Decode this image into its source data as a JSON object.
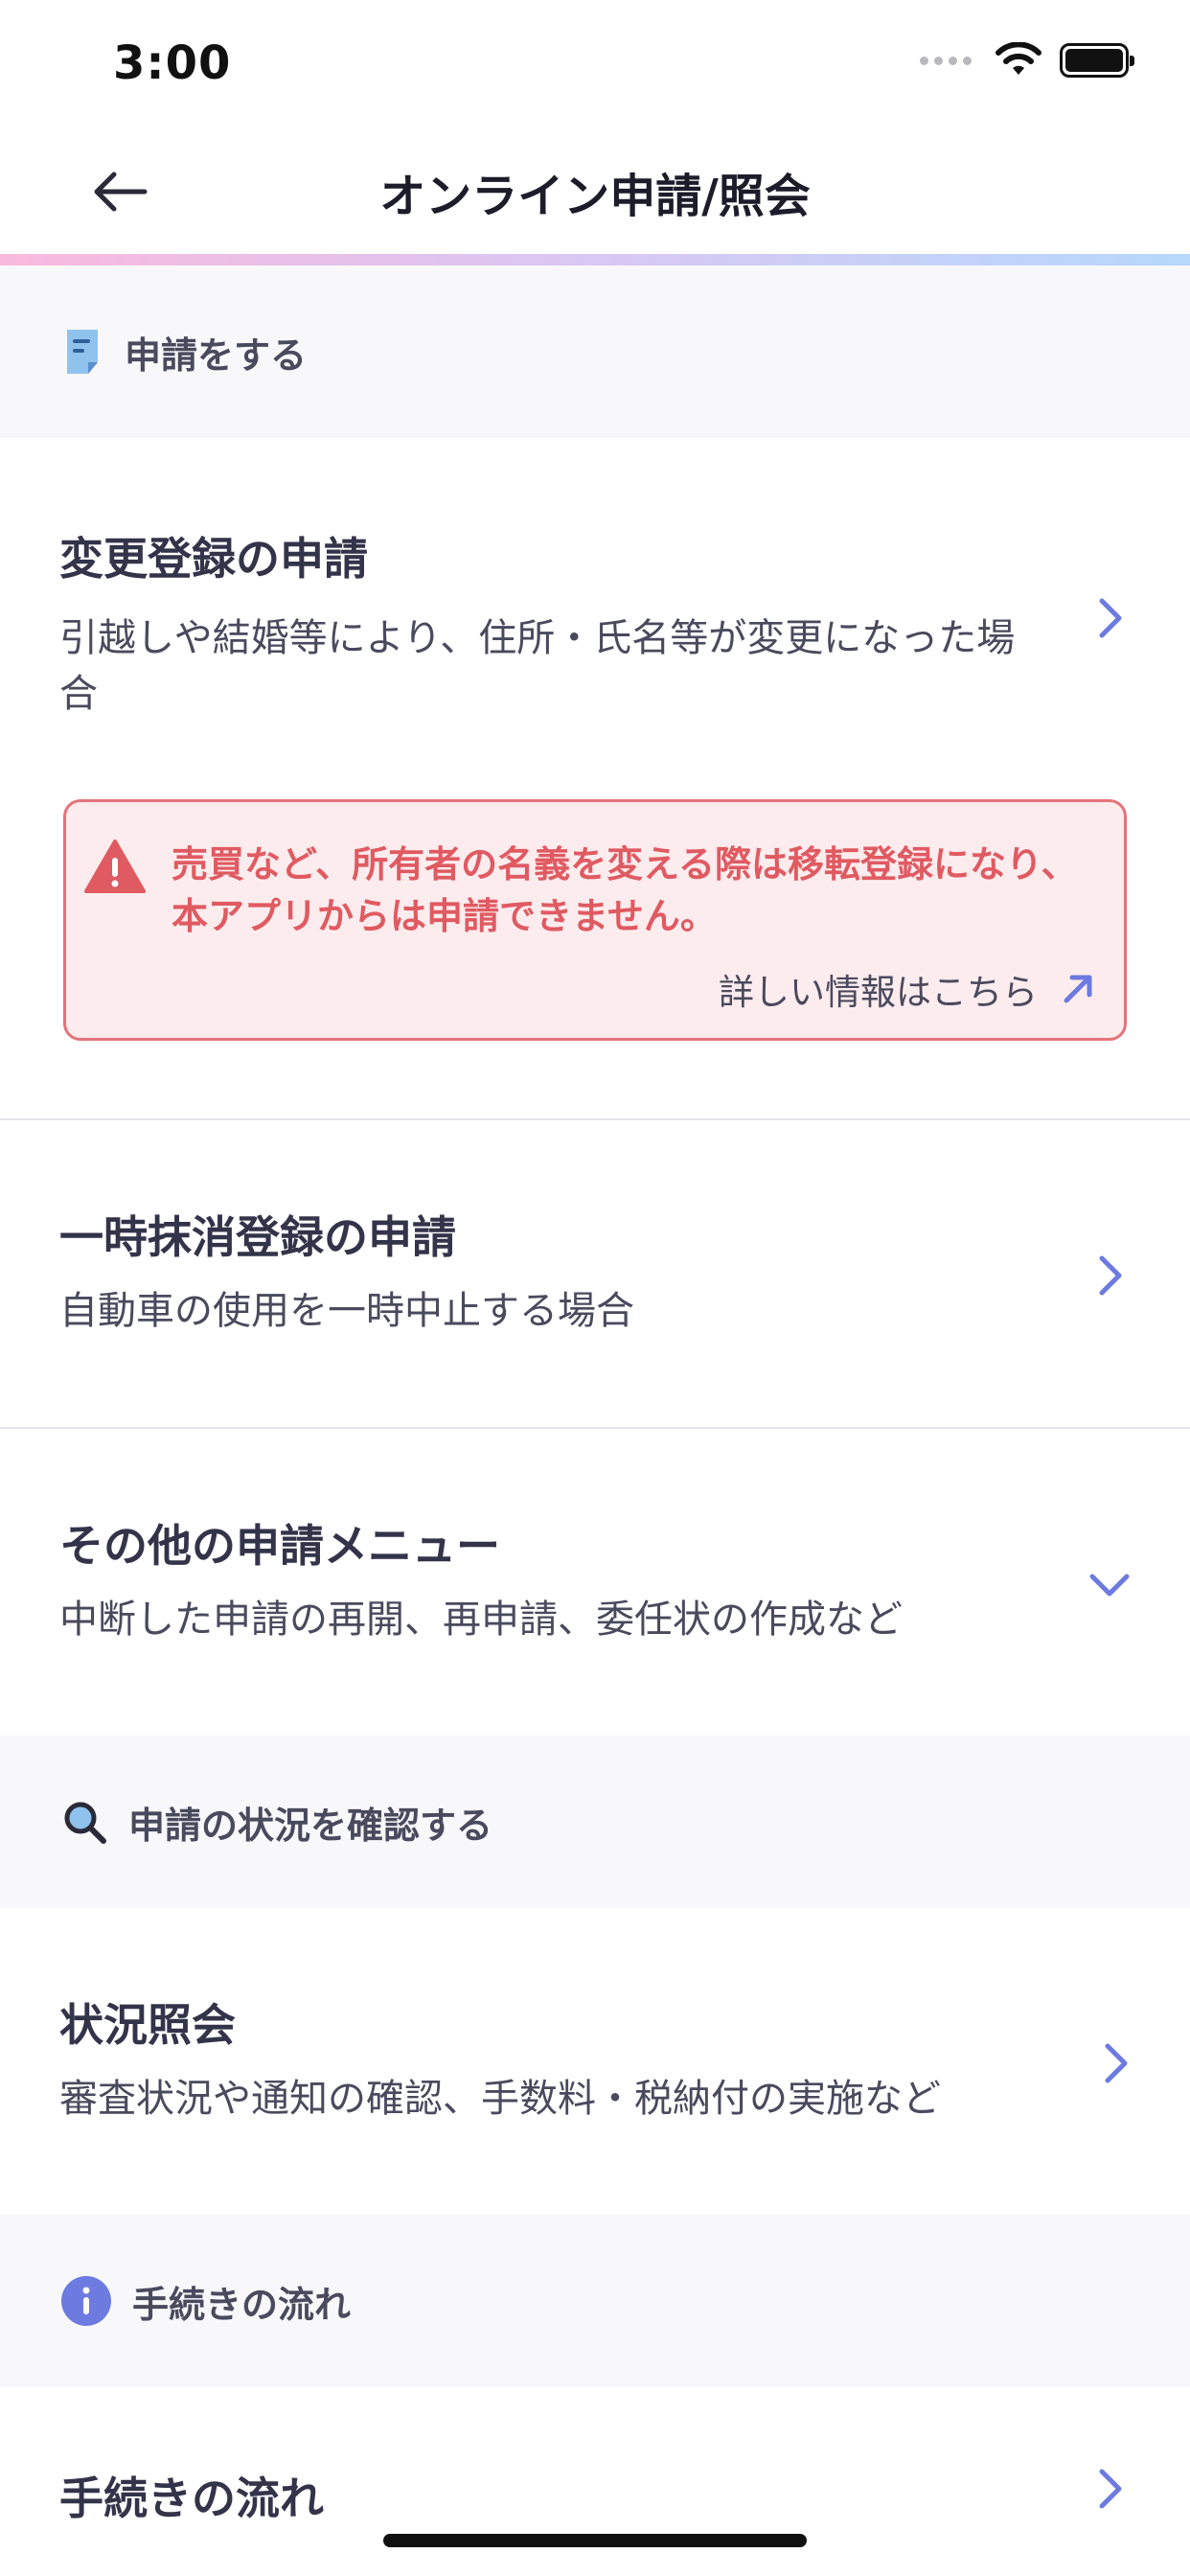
{
  "status_bar": {
    "time": "3:00"
  },
  "nav": {
    "title": "オンライン申請/照会"
  },
  "section_apply": {
    "label": "申請をする"
  },
  "change_registration": {
    "title": "変更登録の申請",
    "description": "引越しや結婚等により、住所・氏名等が変更になった場合"
  },
  "warning": {
    "message": "売買など、所有者の名義を変える際は移転登録になり、本アプリからは申請できません。",
    "link_label": "詳しい情報はこちら"
  },
  "temporary_deregistration": {
    "title": "一時抹消登録の申請",
    "description": "自動車の使用を一時中止する場合"
  },
  "other_menu": {
    "title": "その他の申請メニュー",
    "description": "中断した申請の再開、再申請、委任状の作成など"
  },
  "section_status": {
    "label": "申請の状況を確認する"
  },
  "status_inquiry": {
    "title": "状況照会",
    "description": "審査状況や通知の確認、手数料・税納付の実施など"
  },
  "section_flow": {
    "label": "手続きの流れ"
  },
  "procedure_flow": {
    "title": "手続きの流れ"
  },
  "colors": {
    "accent": "#6d7be0",
    "warning_red": "#e05a62",
    "warning_bg": "#fdeced",
    "section_bg": "#f8f8fb"
  },
  "icons": {
    "section_apply": "document-icon",
    "section_status": "search-icon",
    "section_flow": "info-icon"
  }
}
